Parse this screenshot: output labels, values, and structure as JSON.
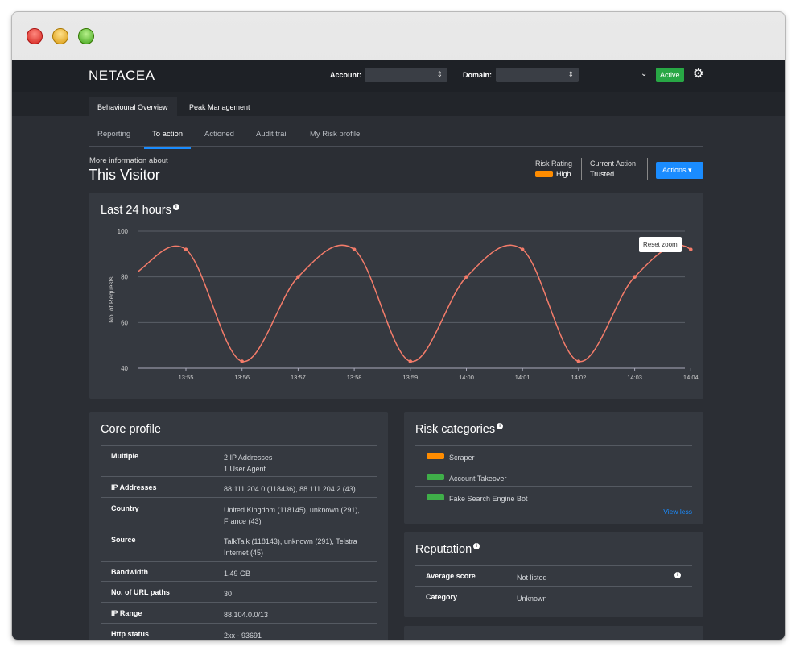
{
  "header": {
    "logo": "NETACEA",
    "account_label": "Account:",
    "domain_label": "Domain:",
    "status": "Active"
  },
  "main_tabs": [
    "Behavioural Overview",
    "Peak Management"
  ],
  "sub_tabs": [
    "Reporting",
    "To action",
    "Actioned",
    "Audit trail",
    "My Risk profile"
  ],
  "visitor": {
    "intro": "More information about",
    "title": "This Visitor",
    "risk_rating_label": "Risk Rating",
    "risk_rating": "High",
    "current_action_label": "Current Action",
    "current_action": "Trusted",
    "actions_button": "Actions"
  },
  "colors": {
    "high": "#ff8c00",
    "green": "#3fae49",
    "line": "#f47c6a",
    "accent": "#1a8cff"
  },
  "chart_card": {
    "title": "Last 24 hours",
    "reset_zoom": "Reset zoom"
  },
  "chart_data": {
    "type": "line",
    "title": "Last 24 hours",
    "xlabel": "",
    "ylabel": "No. of Requests",
    "ylim": [
      40,
      100
    ],
    "yticks": [
      40,
      60,
      80,
      100
    ],
    "categories": [
      "13:55",
      "13:56",
      "13:57",
      "13:58",
      "13:59",
      "14:00",
      "14:01",
      "14:02",
      "14:03",
      "14:04"
    ],
    "series": [
      {
        "name": "Requests",
        "values": [
          92,
          43,
          80,
          92,
          43,
          80,
          92,
          43,
          80,
          92
        ]
      }
    ]
  },
  "core_profile": {
    "title": "Core profile",
    "rows": [
      {
        "key": "Multiple",
        "value": "2 IP Addresses",
        "value2": "1 User Agent"
      },
      {
        "key": "IP Addresses",
        "value": "88.111.204.0 (118436), 88.111.204.2 (43)"
      },
      {
        "key": "Country",
        "value": "United Kingdom (118145), unknown (291), France (43)"
      },
      {
        "key": "Source",
        "value": "TalkTalk (118143), unknown (291), Telstra Internet (45)"
      },
      {
        "key": "Bandwidth",
        "value": "1.49 GB"
      },
      {
        "key": "No. of URL paths",
        "value": "30"
      },
      {
        "key": "IP Range",
        "value": "88.104.0.0/13"
      },
      {
        "key": "Http status",
        "value": "2xx - 93691"
      }
    ]
  },
  "risk_categories": {
    "title": "Risk categories",
    "items": [
      {
        "label": "Scraper",
        "color": "#ff8c00"
      },
      {
        "label": "Account Takeover",
        "color": "#3fae49"
      },
      {
        "label": "Fake Search Engine Bot",
        "color": "#3fae49"
      }
    ],
    "view_less": "View less"
  },
  "reputation": {
    "title": "Reputation",
    "rows": [
      {
        "key": "Average score",
        "value": "Not listed"
      },
      {
        "key": "Category",
        "value": "Unknown"
      }
    ]
  }
}
